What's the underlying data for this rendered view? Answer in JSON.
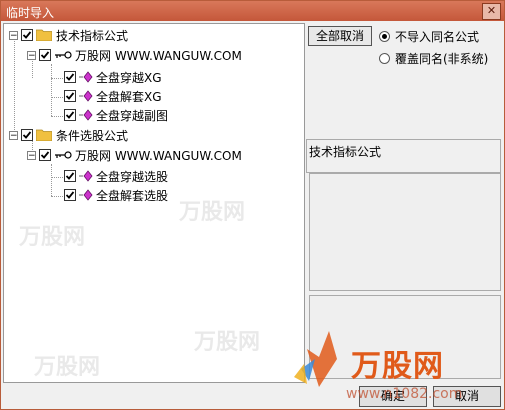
{
  "window": {
    "title": "临时导入",
    "close_glyph": "✕"
  },
  "tree": {
    "nodes": [
      {
        "label": "技术指标公式",
        "kind": "folder",
        "expander": "−"
      },
      {
        "label": "万股网 WWW.WANGUW.COM",
        "kind": "key",
        "expander": "−"
      },
      {
        "label": "全盘穿越XG",
        "kind": "formula"
      },
      {
        "label": "全盘解套XG",
        "kind": "formula"
      },
      {
        "label": "全盘穿越副图",
        "kind": "formula"
      },
      {
        "label": "条件选股公式",
        "kind": "folder",
        "expander": "−"
      },
      {
        "label": "万股网 WWW.WANGUW.COM",
        "kind": "key",
        "expander": "−"
      },
      {
        "label": "全盘穿越选股",
        "kind": "formula"
      },
      {
        "label": "全盘解套选股",
        "kind": "formula"
      }
    ]
  },
  "right": {
    "cancel_all_label": "全部取消",
    "radio_options": [
      {
        "label": "不导入同名公式",
        "selected": true
      },
      {
        "label": "覆盖同名(非系统)",
        "selected": false
      }
    ],
    "section_label": "技术指标公式"
  },
  "footer": {
    "ok_label": "确定",
    "cancel_label": "取消"
  },
  "brand": {
    "name": "万股网",
    "url": "www.n1082.com"
  },
  "watermark_text": "万股网",
  "colors": {
    "title_bar": "#c4573a",
    "brand": "#e05a1a",
    "formula_icon": "#cc33cc",
    "folder_icon": "#f0c040"
  }
}
